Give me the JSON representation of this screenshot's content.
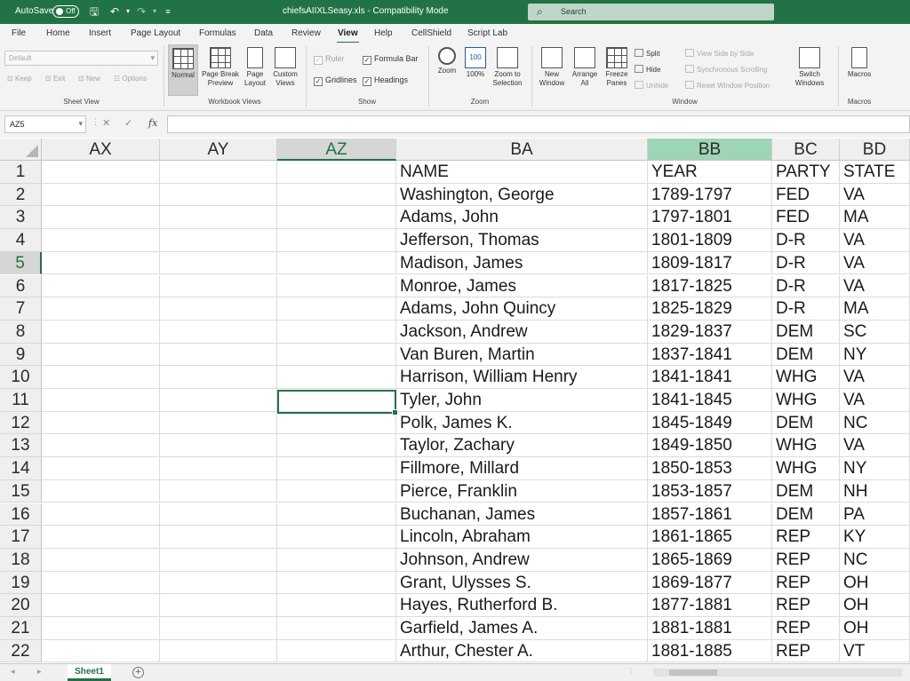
{
  "titlebar": {
    "autosave_label": "AutoSave",
    "autosave_state": "Off",
    "doc_title": "chiefsAIIXLSeasy.xls - Compatibility Mode",
    "search_placeholder": "Search"
  },
  "tabs": [
    "File",
    "Home",
    "Insert",
    "Page Layout",
    "Formulas",
    "Data",
    "Review",
    "View",
    "Help",
    "CellShield",
    "Script Lab"
  ],
  "active_tab": "View",
  "ribbon": {
    "sheet_view": {
      "combo_value": "Default",
      "buttons": [
        "Keep",
        "Exit",
        "New",
        "Options"
      ],
      "label": "Sheet View"
    },
    "workbook_views": {
      "buttons": [
        "Normal",
        "Page Break Preview",
        "Page Layout",
        "Custom Views"
      ],
      "label": "Workbook Views"
    },
    "show": {
      "ruler": "Ruler",
      "formula_bar": "Formula Bar",
      "gridlines": "Gridlines",
      "headings": "Headings",
      "label": "Show"
    },
    "zoom": {
      "buttons": [
        "Zoom",
        "100%",
        "Zoom to Selection"
      ],
      "label": "Zoom"
    },
    "window": {
      "buttons": [
        "New Window",
        "Arrange All",
        "Freeze Panes"
      ],
      "split": "Split",
      "hide": "Hide",
      "unhide": "Unhide",
      "side_by_side": "View Side by Side",
      "sync_scroll": "Synchronous Scrolling",
      "reset_pos": "Reset Window Position",
      "switch": "Switch Windows",
      "label": "Window"
    },
    "macros": {
      "button": "Macros",
      "label": "Macros"
    }
  },
  "formula_bar": {
    "namebox": "AZ5",
    "fx": "fx",
    "value": ""
  },
  "columns": [
    "AX",
    "AY",
    "AZ",
    "BA",
    "BB",
    "BC",
    "BD"
  ],
  "selected_column": "AZ",
  "highlighted_column": "BB",
  "selected_row": 5,
  "rows": [
    [
      "NAME",
      "YEAR",
      "PARTY",
      "STATE"
    ],
    [
      "Washington, George",
      "1789-1797",
      "FED",
      "VA"
    ],
    [
      "Adams, John",
      "1797-1801",
      "FED",
      "MA"
    ],
    [
      "Jefferson, Thomas",
      "1801-1809",
      "D-R",
      "VA"
    ],
    [
      "Madison, James",
      "1809-1817",
      "D-R",
      "VA"
    ],
    [
      "Monroe, James",
      "1817-1825",
      "D-R",
      "VA"
    ],
    [
      "Adams, John Quincy",
      "1825-1829",
      "D-R",
      "MA"
    ],
    [
      "Jackson, Andrew",
      "1829-1837",
      "DEM",
      "SC"
    ],
    [
      "Van Buren, Martin",
      "1837-1841",
      "DEM",
      "NY"
    ],
    [
      "Harrison, William Henry",
      "1841-1841",
      "WHG",
      "VA"
    ],
    [
      "Tyler, John",
      "1841-1845",
      "WHG",
      "VA"
    ],
    [
      "Polk, James K.",
      "1845-1849",
      "DEM",
      "NC"
    ],
    [
      "Taylor, Zachary",
      "1849-1850",
      "WHG",
      "VA"
    ],
    [
      "Fillmore, Millard",
      "1850-1853",
      "WHG",
      "NY"
    ],
    [
      "Pierce, Franklin",
      "1853-1857",
      "DEM",
      "NH"
    ],
    [
      "Buchanan, James",
      "1857-1861",
      "DEM",
      "PA"
    ],
    [
      "Lincoln, Abraham",
      "1861-1865",
      "REP",
      "KY"
    ],
    [
      "Johnson, Andrew",
      "1865-1869",
      "REP",
      "NC"
    ],
    [
      "Grant, Ulysses S.",
      "1869-1877",
      "REP",
      "OH"
    ],
    [
      "Hayes, Rutherford B.",
      "1877-1881",
      "REP",
      "OH"
    ],
    [
      "Garfield, James A.",
      "1881-1881",
      "REP",
      "OH"
    ],
    [
      "Arthur, Chester A.",
      "1881-1885",
      "REP",
      "VT"
    ]
  ],
  "sheets": [
    "Sheet1"
  ],
  "colors": {
    "brand": "#217346",
    "selected_header_fill": "#9fd5b7"
  }
}
